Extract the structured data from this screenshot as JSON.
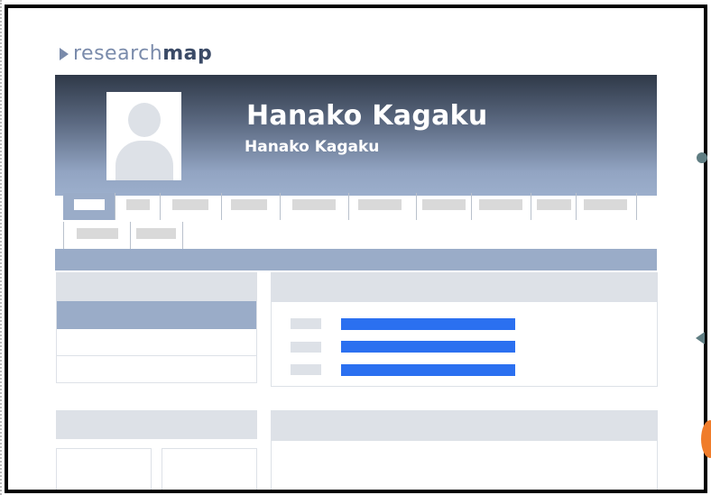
{
  "logo": {
    "part1": "research",
    "part2": "map"
  },
  "profile": {
    "name": "Hanako Kagaku",
    "name_sub": "Hanako Kagaku"
  },
  "tabs": {
    "count_row1": 12,
    "count_row2": 2,
    "active_index": 0
  },
  "content": {
    "list_rows": 3
  },
  "colors": {
    "accent": "#9aacc8",
    "link": "#2b70f0",
    "header_top": "#2f3948",
    "panel": "#dde1e7"
  }
}
